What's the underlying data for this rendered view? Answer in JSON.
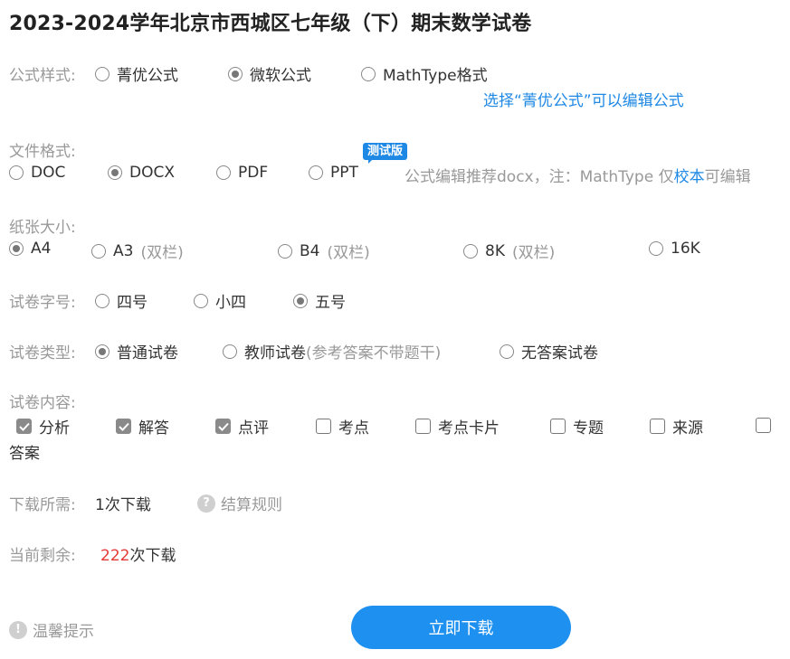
{
  "title": "2023-2024学年北京市西城区七年级（下）期末数学试卷",
  "formula": {
    "label": "公式样式:",
    "options": [
      "菁优公式",
      "微软公式",
      "MathType格式"
    ],
    "hint": "选择“菁优公式”可以编辑公式"
  },
  "file_format": {
    "label": "文件格式:",
    "options": [
      "DOC",
      "DOCX",
      "PDF",
      "PPT"
    ],
    "badge": "测试版",
    "note_prefix": "公式编辑推荐docx，注：MathType 仅",
    "note_link": "校本",
    "note_suffix": "可编辑"
  },
  "paper_size": {
    "label": "纸张大小:",
    "options": [
      {
        "name": "A4",
        "note": ""
      },
      {
        "name": "A3",
        "note": "(双栏)"
      },
      {
        "name": "B4",
        "note": "(双栏)"
      },
      {
        "name": "8K",
        "note": "(双栏)"
      },
      {
        "name": "16K",
        "note": ""
      }
    ]
  },
  "font_size": {
    "label": "试卷字号:",
    "options": [
      "四号",
      "小四",
      "五号"
    ]
  },
  "paper_type": {
    "label": "试卷类型:",
    "options": [
      {
        "name": "普通试卷",
        "note": ""
      },
      {
        "name": "教师试卷",
        "note": "(参考答案不带题干)"
      },
      {
        "name": "无答案试卷",
        "note": ""
      }
    ]
  },
  "content": {
    "label": "试卷内容:",
    "options": [
      "分析",
      "解答",
      "点评",
      "考点",
      "考点卡片",
      "专题",
      "来源",
      "答案"
    ]
  },
  "download_cost": {
    "label": "下载所需:",
    "value": "1次下载",
    "rule": "结算规则",
    "rule_icon": "?"
  },
  "remaining": {
    "label": "当前剩余:",
    "count": "222",
    "unit": "次下载"
  },
  "tip": {
    "icon": "!",
    "label": "温馨提示"
  },
  "download_button": "立即下载",
  "colors": {
    "accent": "#1e88e5",
    "button": "#1e90f0",
    "count": "#e53935",
    "label": "#999999"
  }
}
